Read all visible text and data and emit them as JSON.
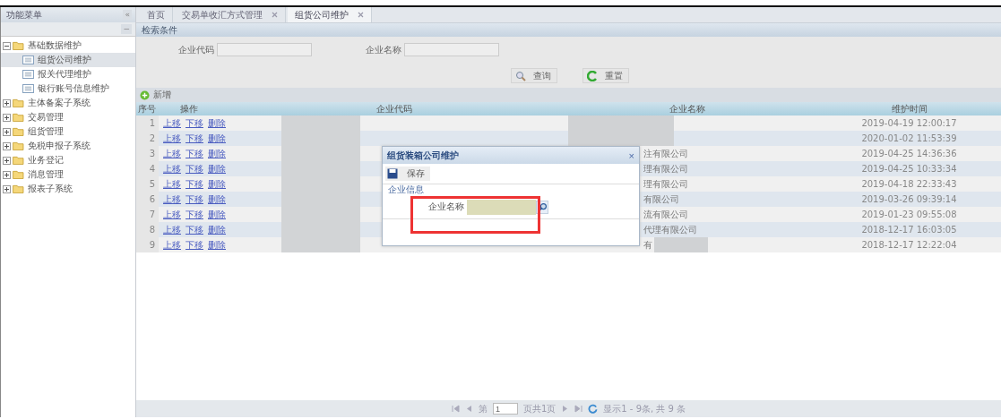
{
  "sidebar": {
    "title": "功能菜单",
    "collapse_glyph": "«",
    "toggle_glyph": "−",
    "tree": [
      {
        "label": "基础数据维护",
        "kind": "folder",
        "expanded": true,
        "selected": false,
        "children": [
          {
            "label": "组货公司维护",
            "kind": "page",
            "selected": true
          },
          {
            "label": "报关代理维护",
            "kind": "page",
            "selected": false
          },
          {
            "label": "银行账号信息维护",
            "kind": "page",
            "selected": false
          }
        ]
      },
      {
        "label": "主体备案子系统",
        "kind": "folder",
        "expanded": false,
        "selected": false
      },
      {
        "label": "交易管理",
        "kind": "folder",
        "expanded": false,
        "selected": false
      },
      {
        "label": "组货管理",
        "kind": "folder",
        "expanded": false,
        "selected": false
      },
      {
        "label": "免税申报子系统",
        "kind": "folder",
        "expanded": false,
        "selected": false
      },
      {
        "label": "业务登记",
        "kind": "folder",
        "expanded": false,
        "selected": false
      },
      {
        "label": "消息管理",
        "kind": "folder",
        "expanded": false,
        "selected": false
      },
      {
        "label": "报表子系统",
        "kind": "folder",
        "expanded": false,
        "selected": false
      }
    ]
  },
  "tabs": [
    {
      "label": "首页",
      "closable": false,
      "selected": false
    },
    {
      "label": "交易单收汇方式管理",
      "closable": true,
      "selected": false
    },
    {
      "label": "组货公司维护",
      "closable": true,
      "selected": true
    }
  ],
  "search_panel": {
    "title": "检索条件",
    "fields": [
      {
        "label": "企业代码"
      },
      {
        "label": "企业名称"
      }
    ],
    "buttons": [
      {
        "label": "查询",
        "kind": "search"
      },
      {
        "label": "重置",
        "kind": "reset"
      }
    ]
  },
  "toolbar": {
    "add": "新增"
  },
  "table": {
    "columns": [
      "序号",
      "操作",
      "企业代码",
      "企业名称",
      "维护时间"
    ],
    "rows": [
      {
        "no": "1",
        "actions": [
          "上移",
          "下移",
          "删除"
        ],
        "code_redacted": true,
        "name": "",
        "name_redacted": true,
        "time": "2019-04-19 12:00:17"
      },
      {
        "no": "2",
        "actions": [
          "上移",
          "下移",
          "删除"
        ],
        "code_redacted": true,
        "name": "",
        "name_redacted": true,
        "time": "2020-01-02 11:53:39"
      },
      {
        "no": "3",
        "actions": [
          "上移",
          "下移",
          "删除"
        ],
        "code_redacted": true,
        "name": "注有限公司",
        "name_redacted": false,
        "time": "2019-04-25 14:36:36"
      },
      {
        "no": "4",
        "actions": [
          "上移",
          "下移",
          "删除"
        ],
        "code_redacted": true,
        "name": "理有限公司",
        "name_redacted": false,
        "time": "2019-04-25 10:33:34"
      },
      {
        "no": "5",
        "actions": [
          "上移",
          "下移",
          "删除"
        ],
        "code_redacted": true,
        "name": "理有限公司",
        "name_redacted": false,
        "time": "2019-04-18 22:33:43"
      },
      {
        "no": "6",
        "actions": [
          "上移",
          "下移",
          "删除"
        ],
        "code_redacted": true,
        "name": "有限公司",
        "name_redacted": false,
        "time": "2019-03-26 09:39:14"
      },
      {
        "no": "7",
        "actions": [
          "上移",
          "下移",
          "删除"
        ],
        "code_redacted": true,
        "name": "流有限公司",
        "name_redacted": false,
        "time": "2019-01-23 09:55:08"
      },
      {
        "no": "8",
        "actions": [
          "上移",
          "下移",
          "删除"
        ],
        "code_redacted": true,
        "name": "代理有限公司",
        "name_redacted": false,
        "time": "2018-12-17 16:03:05"
      },
      {
        "no": "9",
        "actions": [
          "上移",
          "下移",
          "删除"
        ],
        "code_redacted": true,
        "name": "有",
        "name_redacted": true,
        "time": "2018-12-17 12:22:04"
      }
    ]
  },
  "pager": {
    "page_label": "第",
    "page": "1",
    "total_pages": "页共1页",
    "info": "显示1 - 9条, 共 9 条"
  },
  "dialog": {
    "title": "组货装箱公司维护",
    "close": "×",
    "save": "保存",
    "legend": "企业信息",
    "field_label": "企业名称",
    "value_redacted": true,
    "highlighted": true
  }
}
